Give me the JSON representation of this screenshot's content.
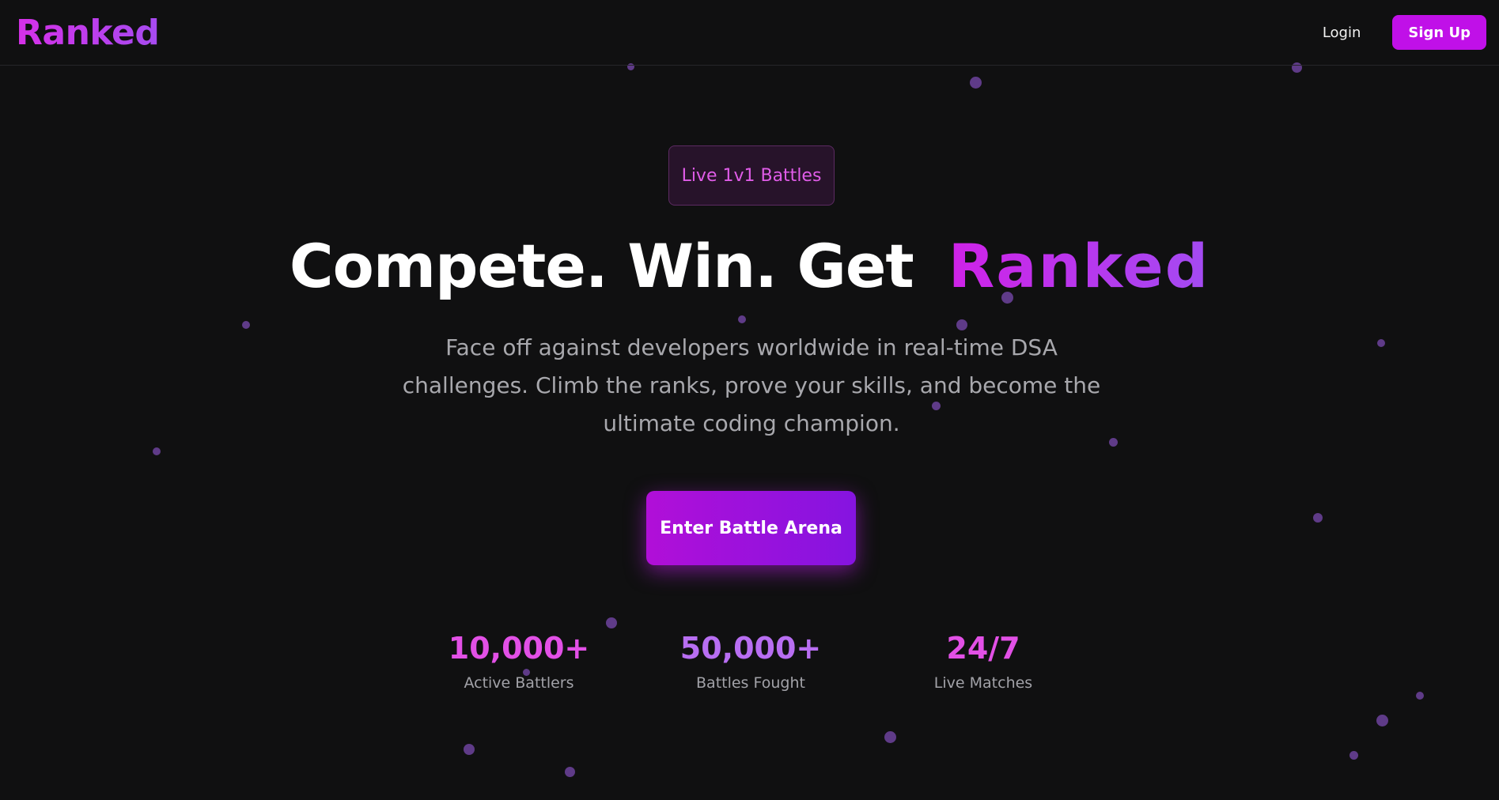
{
  "header": {
    "logo": "Ranked",
    "login_label": "Login",
    "signup_label": "Sign Up"
  },
  "hero": {
    "badge": "Live 1v1 Battles",
    "headline_main": "Compete. Win. Get",
    "headline_accent": "Ranked",
    "subtext": "Face off against developers worldwide in real-time DSA challenges. Climb the ranks, prove your skills, and become the ultimate coding champion.",
    "cta_label": "Enter Battle Arena"
  },
  "stats": [
    {
      "value": "10,000+",
      "label": "Active Battlers"
    },
    {
      "value": "50,000+",
      "label": "Battles Fought"
    },
    {
      "value": "24/7",
      "label": "Live Matches"
    }
  ],
  "colors": {
    "background": "#101011",
    "accent_pink": "#d630e8",
    "accent_purple": "#a64bf0",
    "dot": "#7a4ab0"
  }
}
